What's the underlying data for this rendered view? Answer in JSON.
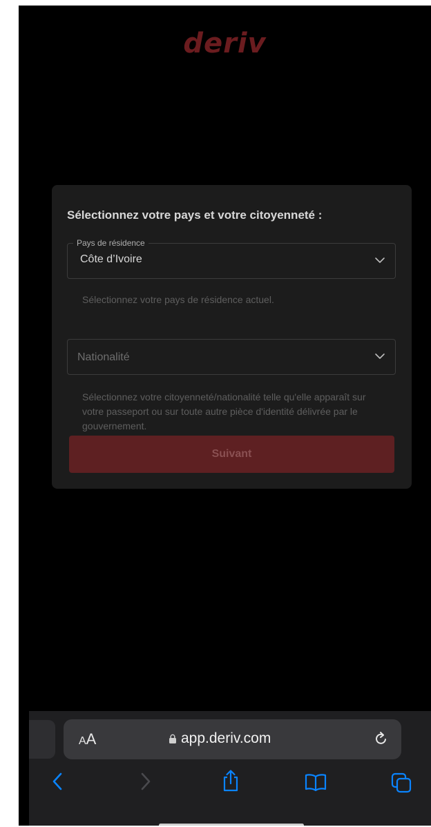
{
  "app": {
    "logo_text": "deriv",
    "brand_color": "#6b1c1f"
  },
  "modal": {
    "title": "Sélectionnez votre pays et votre citoyenneté :",
    "residence": {
      "label": "Pays de résidence",
      "value": "Côte d’Ivoire",
      "helper": "Sélectionnez votre pays de résidence actuel."
    },
    "nationality": {
      "placeholder": "Nationalité",
      "helper": "Sélectionnez votre citoyenneté/nationalité telle qu'elle apparaît sur votre passeport ou sur toute autre pièce d'identité délivrée par le gouvernement."
    },
    "next_button_label": "Suivant"
  },
  "browser": {
    "text_size_label_small": "A",
    "text_size_label_large": "A",
    "url": "app.deriv.com",
    "icons": [
      "lock-icon",
      "reload-icon",
      "back-icon",
      "forward-icon",
      "share-icon",
      "bookmarks-icon",
      "tabs-icon"
    ],
    "accent_color": "#0a84ff"
  }
}
